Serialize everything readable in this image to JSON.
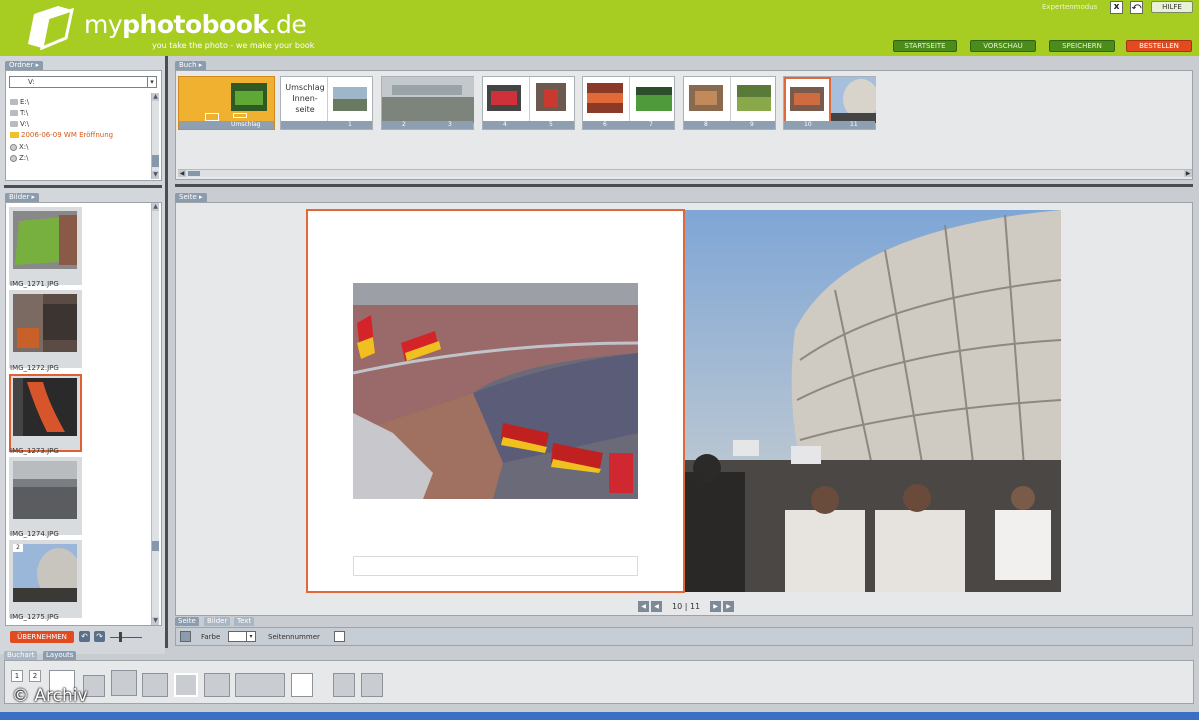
{
  "header": {
    "brand_pre": "my",
    "brand_bold": "photobook",
    "brand_post": ".de",
    "tagline": "you take the photo - we make your book",
    "expert_mode": "Expertenmodus",
    "close_glyph": "x",
    "help": "HILFE",
    "nav": [
      "STARTSEITE",
      "VORSCHAU",
      "SPEICHERN",
      "BESTELLEN"
    ]
  },
  "folders": {
    "title": "Ordner",
    "drive_select": "V:",
    "tree": [
      "E:\\",
      "T:\\",
      "V:\\",
      "2006-06-09 WM Eröffnung",
      "X:\\",
      "Z:\\"
    ]
  },
  "images": {
    "title": "Bilder",
    "items": [
      "IMG_1271.JPG",
      "IMG_1272.JPG",
      "IMG_1273.JPG",
      "IMG_1274.JPG",
      "IMG_1275.JPG"
    ],
    "accept": "ÜBERNEHMEN",
    "count_badge": "2"
  },
  "book": {
    "title": "Buch",
    "cover_label": "Umschlag",
    "inside_cover": "Umschlag Innen- seite",
    "page_numbers": [
      "1",
      "2",
      "3",
      "4",
      "5",
      "6",
      "7",
      "8",
      "9",
      "10",
      "11"
    ]
  },
  "page": {
    "title": "Seite",
    "pager": "10 | 11",
    "tabs": [
      "Seite",
      "Bilder",
      "Text"
    ],
    "color_label": "Farbe",
    "page_number_label": "Seitennummer"
  },
  "bottom": {
    "tabs": [
      "Buchart",
      "Layouts"
    ],
    "layout_nums": [
      "1",
      "2"
    ],
    "watermark": "© Archiv"
  }
}
